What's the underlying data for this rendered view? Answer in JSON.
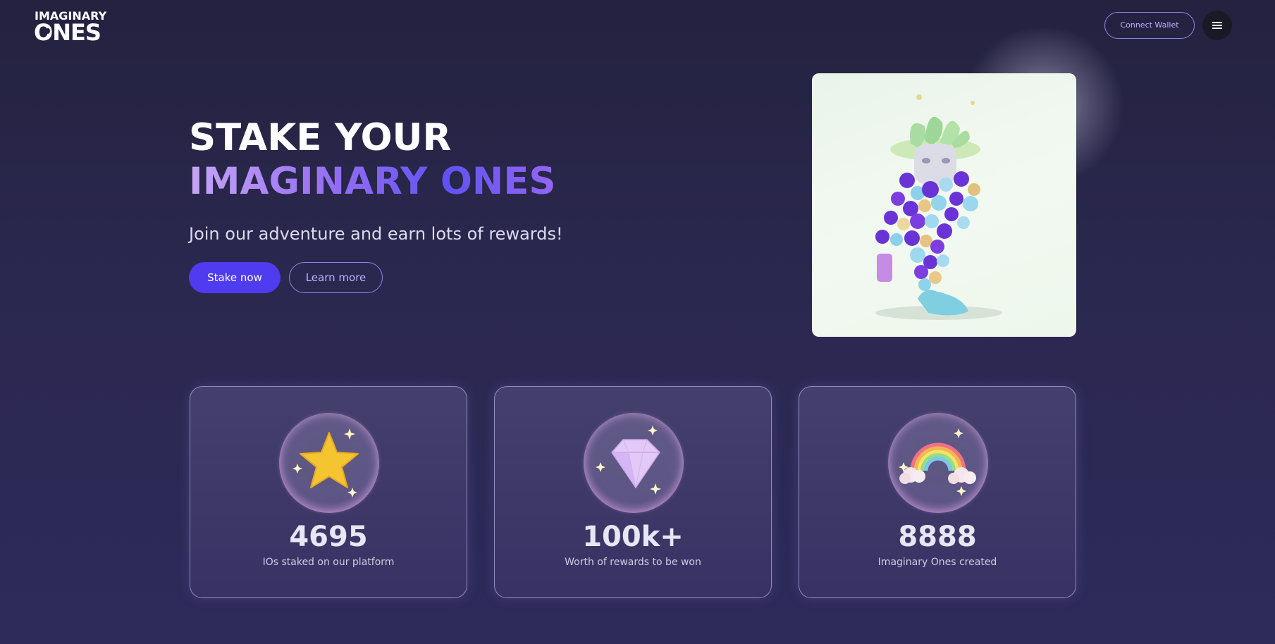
{
  "header": {
    "logo_line1": "IMAGINARY",
    "logo_line2": "ONES",
    "connect_wallet_label": "Connect Wallet",
    "menu_icon": "hamburger-menu-icon"
  },
  "hero": {
    "title_line1": "STAKE YOUR",
    "title_line2": "IMAGINARY ONES",
    "subtitle": "Join our adventure and earn lots of rewards!",
    "primary_button": "Stake now",
    "secondary_button": "Learn more",
    "image": "imaginary-one-character-illustration"
  },
  "stats": [
    {
      "value": "4695",
      "label": "IOs staked on our platform",
      "icon": "star-bubble-icon"
    },
    {
      "value": "100k+",
      "label": "Worth of rewards to be won",
      "icon": "diamond-bubble-icon"
    },
    {
      "value": "8888",
      "label": "Imaginary Ones created",
      "icon": "rainbow-bubble-icon"
    }
  ],
  "colors": {
    "background": "#2a274b",
    "accent": "#4f3bf0",
    "accent_light": "#8d86e8",
    "title_gradient_start": "#c6a6f6",
    "title_gradient_end": "#6152f2"
  }
}
